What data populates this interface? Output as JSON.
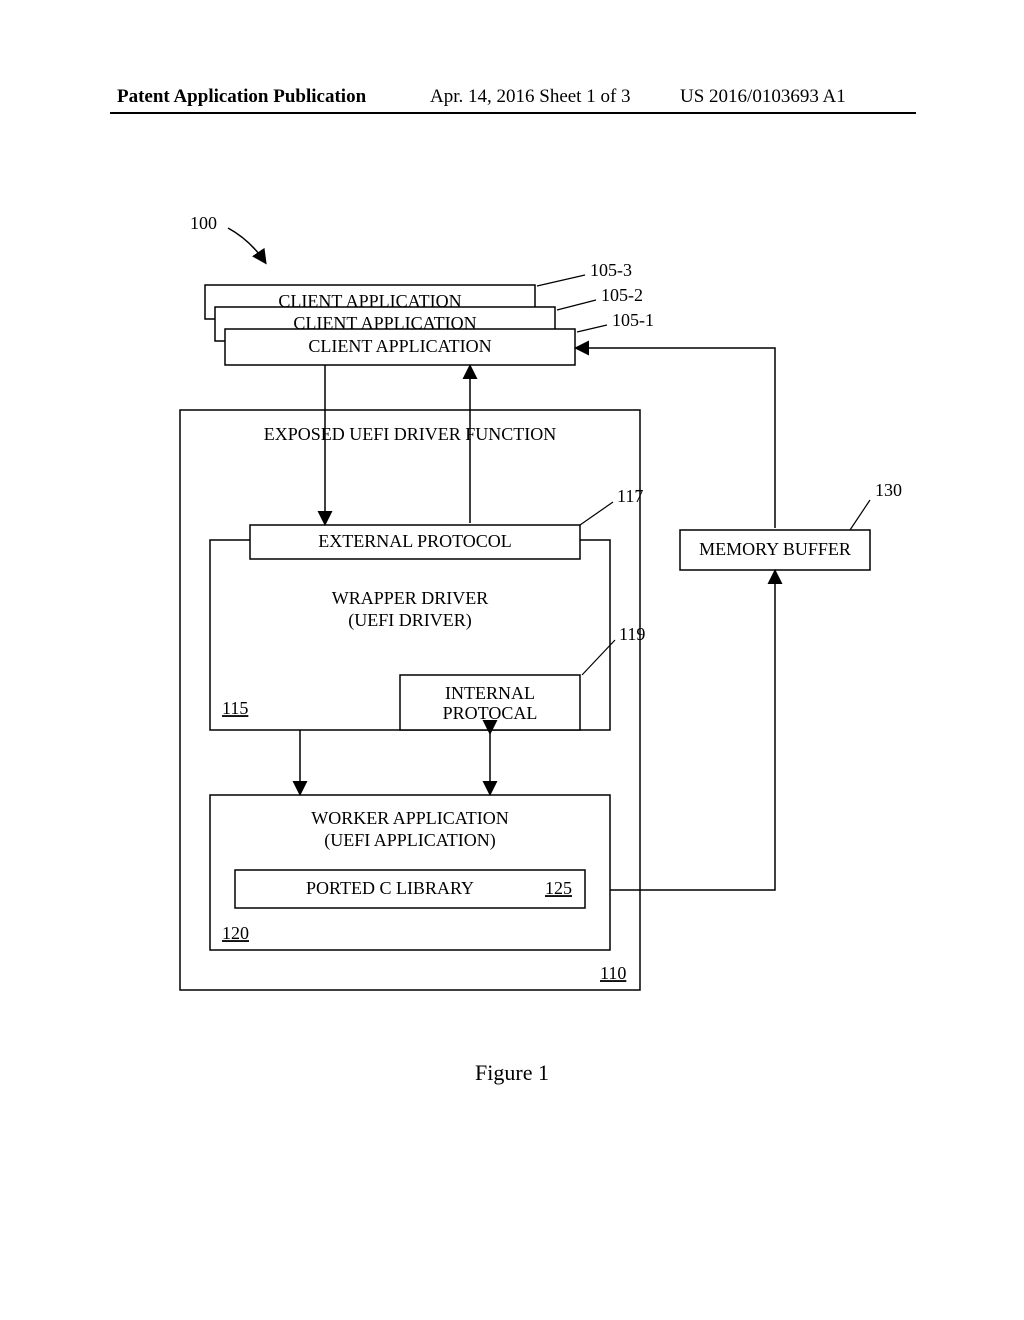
{
  "header": {
    "left": "Patent Application Publication",
    "mid": "Apr. 14, 2016  Sheet 1 of 3",
    "right": "US 2016/0103693 A1"
  },
  "figure_caption": "Figure 1",
  "refs": {
    "r100": "100",
    "r105_1": "105-1",
    "r105_2": "105-2",
    "r105_3": "105-3",
    "r110": "110",
    "r115": "115",
    "r117": "117",
    "r119": "119",
    "r120": "120",
    "r125": "125",
    "r130": "130"
  },
  "boxes": {
    "client3": "CLIENT APPLICATION",
    "client2": "CLIENT APPLICATION",
    "client1": "CLIENT APPLICATION",
    "exposed": "EXPOSED UEFI DRIVER FUNCTION",
    "external": "EXTERNAL PROTOCOL",
    "wrapper_line1": "WRAPPER DRIVER",
    "wrapper_line2": "(UEFI DRIVER)",
    "internal_line1": "INTERNAL",
    "internal_line2": "PROTOCAL",
    "worker_line1": "WORKER APPLICATION",
    "worker_line2": "(UEFI APPLICATION)",
    "ported": "PORTED C LIBRARY",
    "memory": "MEMORY BUFFER"
  },
  "chart_data": {
    "type": "diagram",
    "title": "Figure 1",
    "reference_numeral_system": "100",
    "components": [
      {
        "ref": "105-1",
        "label": "CLIENT APPLICATION"
      },
      {
        "ref": "105-2",
        "label": "CLIENT APPLICATION"
      },
      {
        "ref": "105-3",
        "label": "CLIENT APPLICATION"
      },
      {
        "ref": "110",
        "label": "EXPOSED UEFI DRIVER FUNCTION",
        "contains": [
          "115",
          "120"
        ]
      },
      {
        "ref": "115",
        "label": "WRAPPER DRIVER (UEFI DRIVER)",
        "contains": [
          "117",
          "119"
        ]
      },
      {
        "ref": "117",
        "label": "EXTERNAL PROTOCOL"
      },
      {
        "ref": "119",
        "label": "INTERNAL PROTOCAL"
      },
      {
        "ref": "120",
        "label": "WORKER APPLICATION (UEFI APPLICATION)",
        "contains": [
          "125"
        ]
      },
      {
        "ref": "125",
        "label": "PORTED C LIBRARY"
      },
      {
        "ref": "130",
        "label": "MEMORY BUFFER"
      }
    ],
    "connections": [
      {
        "from": "105",
        "to": "117",
        "dir": "uni",
        "desc": "client application to external protocol"
      },
      {
        "from": "117",
        "to": "105",
        "dir": "uni",
        "desc": "external protocol to client application (via wrapper)"
      },
      {
        "from": "115",
        "to": "120",
        "dir": "uni",
        "desc": "wrapper driver to worker application"
      },
      {
        "from": "119",
        "to": "120",
        "dir": "bi",
        "desc": "internal protocol to worker application"
      },
      {
        "from": "120",
        "to": "130",
        "dir": "uni",
        "desc": "worker application to memory buffer"
      },
      {
        "from": "130",
        "to": "105",
        "dir": "uni",
        "desc": "memory buffer to client application"
      }
    ]
  }
}
